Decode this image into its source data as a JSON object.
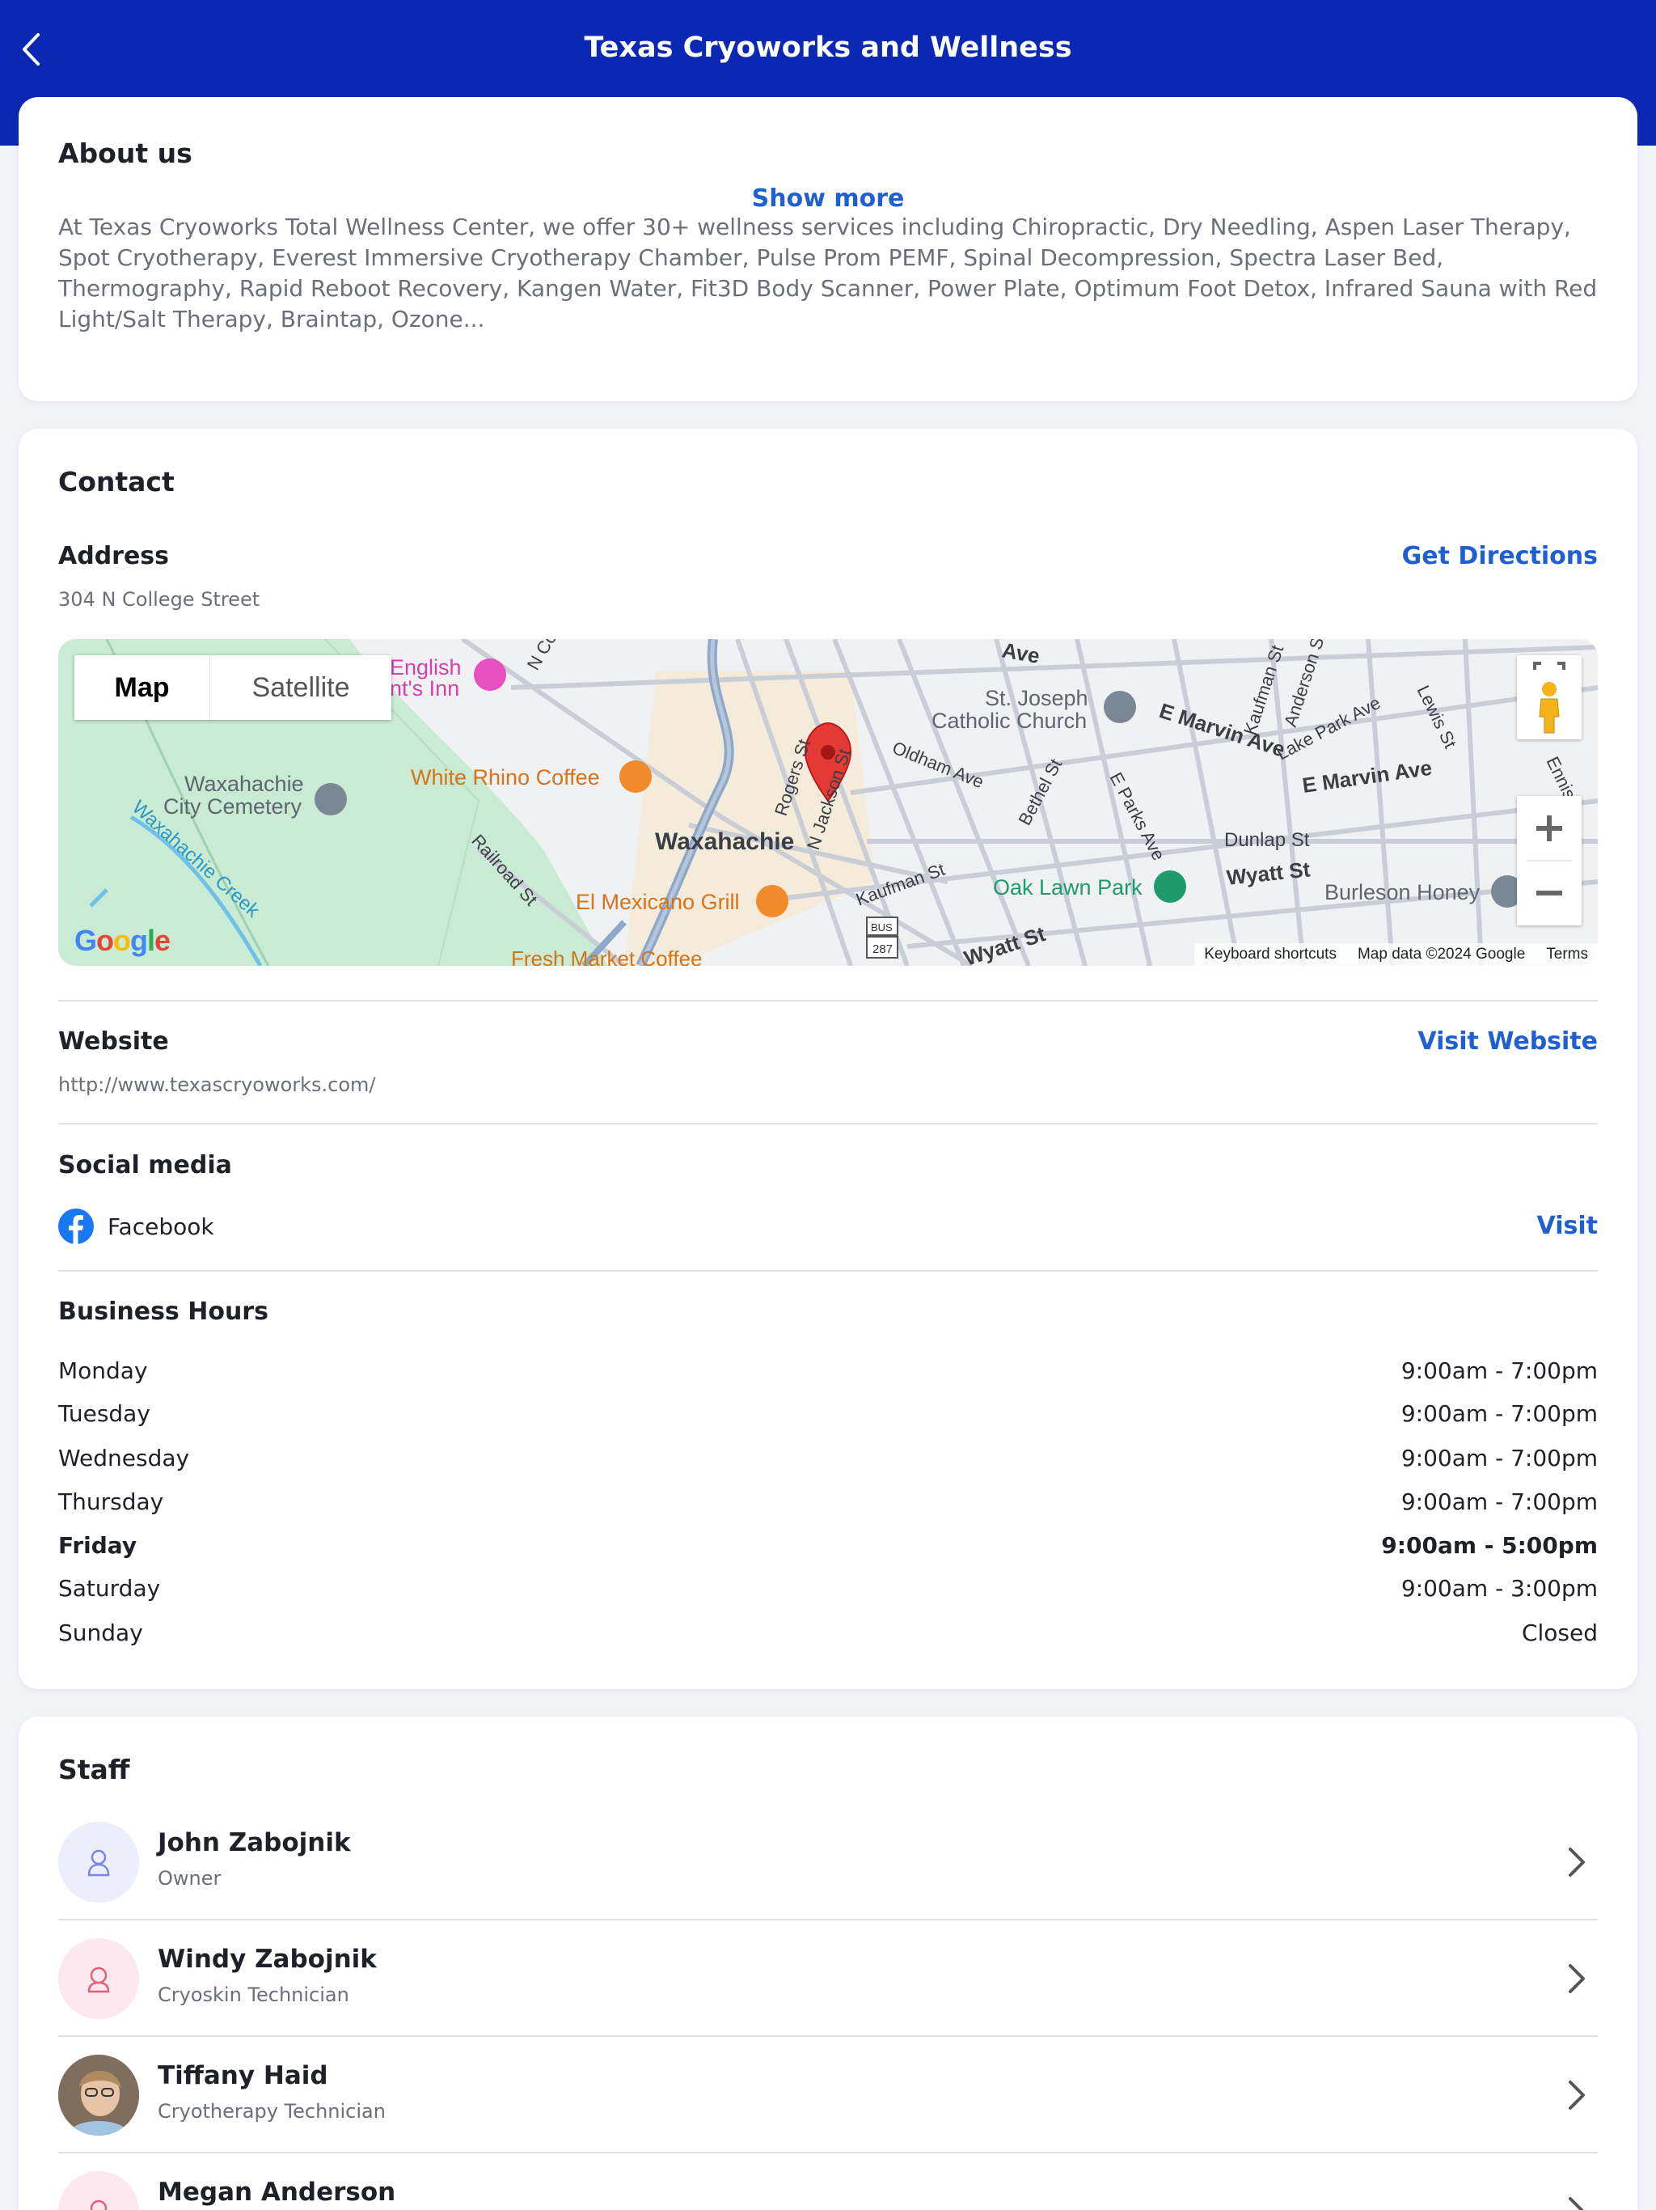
{
  "header": {
    "title": "Texas Cryoworks and Wellness"
  },
  "about": {
    "title": "About us",
    "description": "At Texas Cryoworks Total Wellness Center, we offer 30+ wellness services including Chiropractic, Dry Needling, Aspen Laser Therapy, Spot Cryotherapy, Everest Immersive Cryotherapy Chamber, Pulse Prom PEMF, Spinal Decompression, Spectra Laser Bed, Thermography, Rapid Reboot Recovery, Kangen Water, Fit3D Body Scanner, Power Plate, Optimum Foot Detox, Infrared Sauna with Red Light/Salt Therapy, Braintap, Ozone...",
    "show_more": "Show more"
  },
  "contact": {
    "title": "Contact",
    "address_label": "Address",
    "address": "304 N College Street",
    "directions": "Get Directions",
    "website_label": "Website",
    "website_url": "http://www.texascryoworks.com/",
    "visit_website": "Visit Website",
    "social_label": "Social media",
    "facebook": "Facebook",
    "visit": "Visit",
    "hours_label": "Business Hours",
    "hours": [
      {
        "day": "Monday",
        "time": "9:00am - 7:00pm"
      },
      {
        "day": "Tuesday",
        "time": "9:00am - 7:00pm"
      },
      {
        "day": "Wednesday",
        "time": "9:00am - 7:00pm"
      },
      {
        "day": "Thursday",
        "time": "9:00am - 7:00pm"
      },
      {
        "day": "Friday",
        "time": "9:00am - 5:00pm"
      },
      {
        "day": "Saturday",
        "time": "9:00am - 3:00pm"
      },
      {
        "day": "Sunday",
        "time": "Closed"
      }
    ]
  },
  "map": {
    "map_tab": "Map",
    "satellite_tab": "Satellite",
    "google": "Google",
    "keyboard": "Keyboard shortcuts",
    "mapdata": "Map data ©2024 Google",
    "terms": "Terms",
    "labels": {
      "waxahachie": "Waxahachie",
      "cemetery1": "Waxahachie",
      "cemetery2": "City Cemetery",
      "creek": "Waxahachie Creek",
      "white_rhino": "White Rhino Coffee",
      "el_mexicano": "El Mexicano Grill",
      "english1": "English",
      "english2": "nt's Inn",
      "st_joseph1": "St. Joseph",
      "st_joseph2": "Catholic Church",
      "oak_lawn": "Oak Lawn Park",
      "burleson": "Burleson Honey",
      "e_marvin": "E Marvin Ave",
      "e_marvin2": "E Marvin Ave",
      "wyatt": "Wyatt St",
      "wyatt2": "Wyatt St",
      "dunlap": "Dunlap St",
      "kaufman": "Kaufman St",
      "oldham": "Oldham Ave",
      "railroad": "Railroad St",
      "rogers": "Rogers St",
      "jackson": "N Jackson St",
      "college": "N Co",
      "lake_park": "Lake Park Ave",
      "bethel": "Bethel St",
      "parks": "E Parks Ave",
      "anderson": "Anderson St",
      "kaufman2": "Kaufman St",
      "lewis": "Lewis St",
      "ennis": "Ennis",
      "fresh": "Fresh Market Coffee",
      "bus": "BUS",
      "route": "287",
      "ave": "Ave"
    }
  },
  "staff": {
    "title": "Staff",
    "members": [
      {
        "name": "John Zabojnik",
        "role": "Owner"
      },
      {
        "name": "Windy Zabojnik",
        "role": "Cryoskin Technician"
      },
      {
        "name": "Tiffany Haid",
        "role": "Cryotherapy Technician"
      },
      {
        "name": "Megan Anderson",
        "role": ""
      }
    ]
  },
  "colors": {
    "header": "#0a28b4",
    "link": "#1f5fd1",
    "facebook": "#1877f2"
  },
  "icons": {
    "back": "chevron-left-icon",
    "facebook": "facebook-icon",
    "row": "chevron-right-icon"
  }
}
